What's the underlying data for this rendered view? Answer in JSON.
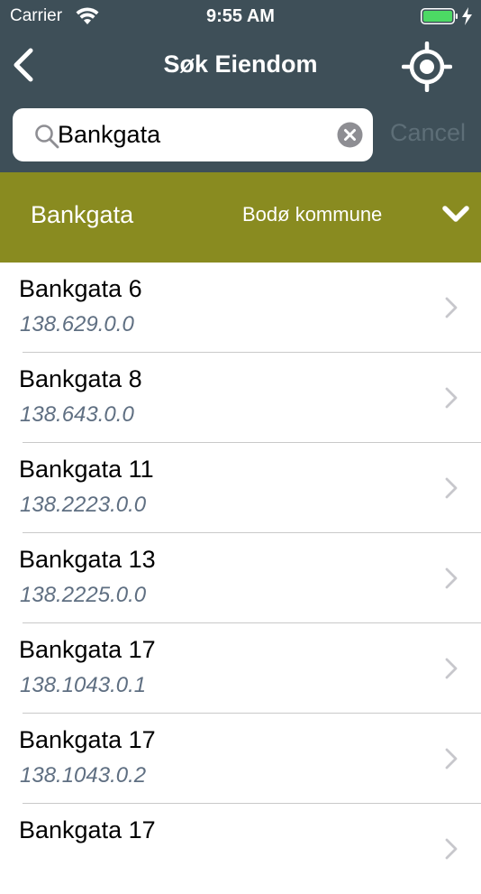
{
  "status_bar": {
    "carrier": "Carrier",
    "time": "9:55 AM"
  },
  "nav": {
    "title": "Søk Eiendom",
    "back_icon": "chevron-left-icon",
    "locate_icon": "crosshair-icon"
  },
  "search": {
    "value": "Bankgata",
    "placeholder": "",
    "cancel_label": "Cancel"
  },
  "filter": {
    "street": "Bankgata",
    "municipality": "Bodø kommune"
  },
  "results": [
    {
      "title": "Bankgata 6",
      "id": "138.629.0.0"
    },
    {
      "title": "Bankgata 8",
      "id": "138.643.0.0"
    },
    {
      "title": "Bankgata 11",
      "id": "138.2223.0.0"
    },
    {
      "title": "Bankgata 13",
      "id": "138.2225.0.0"
    },
    {
      "title": "Bankgata 17",
      "id": "138.1043.0.1"
    },
    {
      "title": "Bankgata 17",
      "id": "138.1043.0.2"
    },
    {
      "title": "Bankgata 17",
      "id": ""
    }
  ],
  "colors": {
    "header": "#3e4f58",
    "filter_bar": "#898b20",
    "subtitle": "#5f6f82",
    "battery": "#4cd964"
  }
}
